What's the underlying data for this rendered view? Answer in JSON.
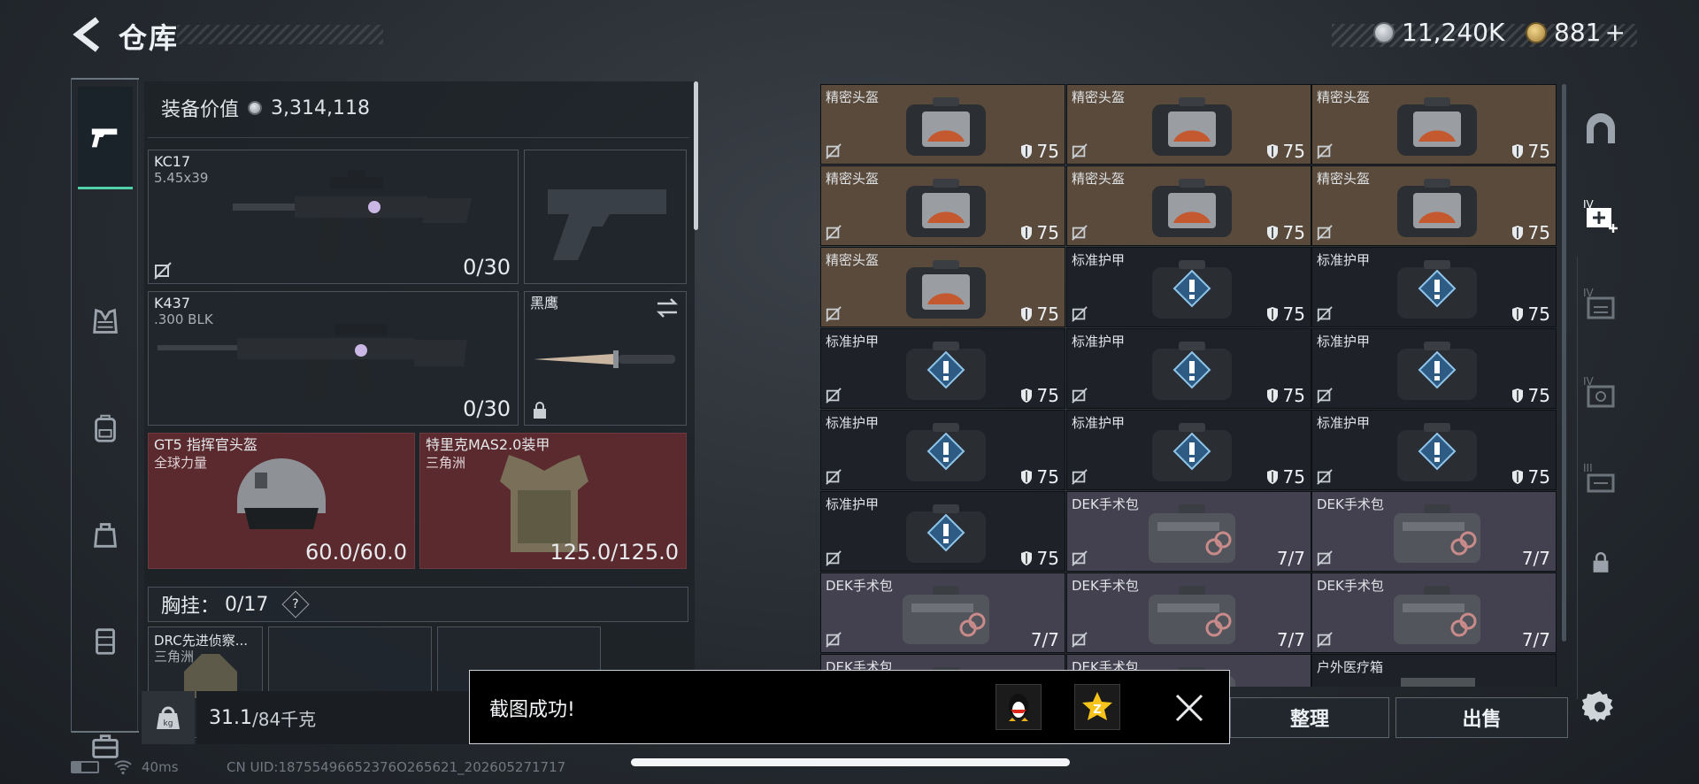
{
  "header": {
    "title": "仓库",
    "silver": "11,240K",
    "gold": "881",
    "gold_plus": "+"
  },
  "equipment": {
    "value_label": "装备价值",
    "value": "3,314,118",
    "weapons": [
      {
        "name": "KC17",
        "caliber": "5.45x39",
        "ammo": "0/30"
      },
      {
        "name": "K437",
        "caliber": ".300 BLK",
        "ammo": "0/30"
      }
    ],
    "melee": {
      "name": "黑鹰"
    },
    "helmet": {
      "name": "GT5 指挥官头盔",
      "brand": "全球力量",
      "durability": "60.0/60.0"
    },
    "armor": {
      "name": "特里克MAS2.0装甲",
      "brand": "三角洲",
      "durability": "125.0/125.0"
    },
    "chest_rig": {
      "label": "胸挂：",
      "capacity": "0/17",
      "help": "?"
    },
    "rig_item": {
      "name": "DRC先进侦察...",
      "brand": "三角洲"
    }
  },
  "weight": {
    "current": "31.1",
    "max": "/84千克"
  },
  "grid": {
    "items": [
      {
        "name": "精密头盔",
        "value": "75",
        "kind": "helmet"
      },
      {
        "name": "精密头盔",
        "value": "75",
        "kind": "helmet"
      },
      {
        "name": "精密头盔",
        "value": "75",
        "kind": "helmet"
      },
      {
        "name": "精密头盔",
        "value": "75",
        "kind": "helmet"
      },
      {
        "name": "精密头盔",
        "value": "75",
        "kind": "helmet"
      },
      {
        "name": "精密头盔",
        "value": "75",
        "kind": "helmet"
      },
      {
        "name": "精密头盔",
        "value": "75",
        "kind": "helmet"
      },
      {
        "name": "标准护甲",
        "value": "75",
        "kind": "armor"
      },
      {
        "name": "标准护甲",
        "value": "75",
        "kind": "armor"
      },
      {
        "name": "标准护甲",
        "value": "75",
        "kind": "armor"
      },
      {
        "name": "标准护甲",
        "value": "75",
        "kind": "armor"
      },
      {
        "name": "标准护甲",
        "value": "75",
        "kind": "armor"
      },
      {
        "name": "标准护甲",
        "value": "75",
        "kind": "armor"
      },
      {
        "name": "标准护甲",
        "value": "75",
        "kind": "armor"
      },
      {
        "name": "标准护甲",
        "value": "75",
        "kind": "armor"
      },
      {
        "name": "标准护甲",
        "value": "75",
        "kind": "armor"
      },
      {
        "name": "DEK手术包",
        "value": "7/7",
        "kind": "medkit"
      },
      {
        "name": "DEK手术包",
        "value": "7/7",
        "kind": "medkit"
      },
      {
        "name": "DEK手术包",
        "value": "7/7",
        "kind": "medkit"
      },
      {
        "name": "DEK手术包",
        "value": "7/7",
        "kind": "medkit"
      },
      {
        "name": "DEK手术包",
        "value": "7/7",
        "kind": "medkit"
      },
      {
        "name": "DEK手术包",
        "value": "",
        "kind": "medkit"
      },
      {
        "name": "DEK手术包",
        "value": "",
        "kind": "medkit"
      },
      {
        "name": "户外医疗箱",
        "value": "",
        "kind": "box"
      }
    ]
  },
  "actions": {
    "sort": "整理",
    "sell": "出售"
  },
  "toast": {
    "message": "截图成功!"
  },
  "status": {
    "ping": "40ms",
    "uid": "CN UID:18755496652376O265621_202605271717"
  },
  "colors": {
    "accent": "#4fd0a6",
    "helmet_bg": "#5a4a3b",
    "armor_bg": "#1e2228",
    "medkit_bg": "#43404f",
    "equip_red": "#5a2a2e"
  }
}
